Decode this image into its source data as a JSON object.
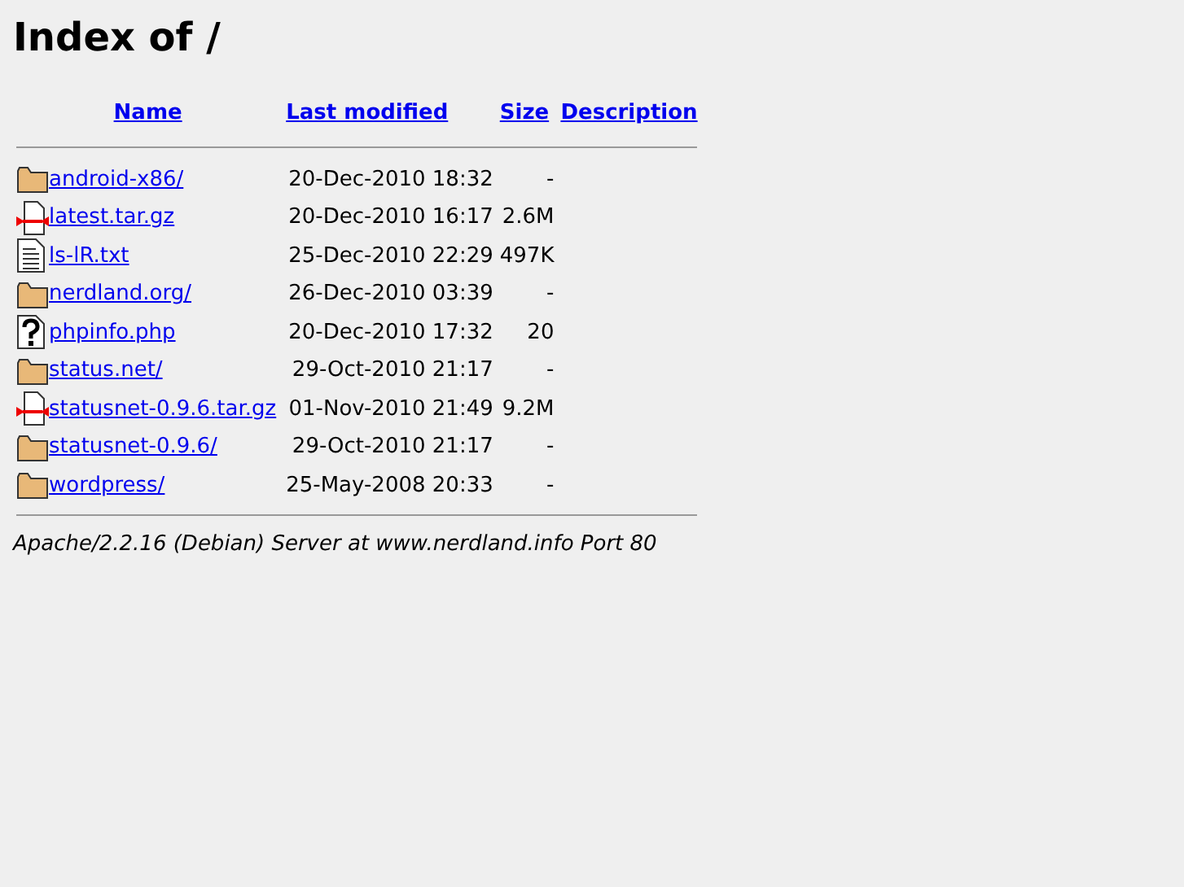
{
  "title": "Index of /",
  "columns": [
    "Name",
    "Last modified",
    "Size",
    "Description"
  ],
  "rows": [
    {
      "kind": "folder",
      "name": "android-x86/",
      "modified": "20-Dec-2010 18:32",
      "size": "-"
    },
    {
      "kind": "archive",
      "name": "latest.tar.gz",
      "modified": "20-Dec-2010 16:17",
      "size": "2.6M"
    },
    {
      "kind": "text",
      "name": "ls-lR.txt",
      "modified": "25-Dec-2010 22:29",
      "size": "497K"
    },
    {
      "kind": "folder",
      "name": "nerdland.org/",
      "modified": "26-Dec-2010 03:39",
      "size": "-"
    },
    {
      "kind": "unknown",
      "name": "phpinfo.php",
      "modified": "20-Dec-2010 17:32",
      "size": "20"
    },
    {
      "kind": "folder",
      "name": "status.net/",
      "modified": "29-Oct-2010 21:17",
      "size": "-"
    },
    {
      "kind": "archive",
      "name": "statusnet-0.9.6.tar.gz",
      "modified": "01-Nov-2010 21:49",
      "size": "9.2M"
    },
    {
      "kind": "folder",
      "name": "statusnet-0.9.6/",
      "modified": "29-Oct-2010 21:17",
      "size": "-"
    },
    {
      "kind": "folder",
      "name": "wordpress/",
      "modified": "25-May-2008 20:33",
      "size": "-"
    }
  ],
  "footer": "Apache/2.2.16 (Debian) Server at www.nerdland.info Port 80"
}
